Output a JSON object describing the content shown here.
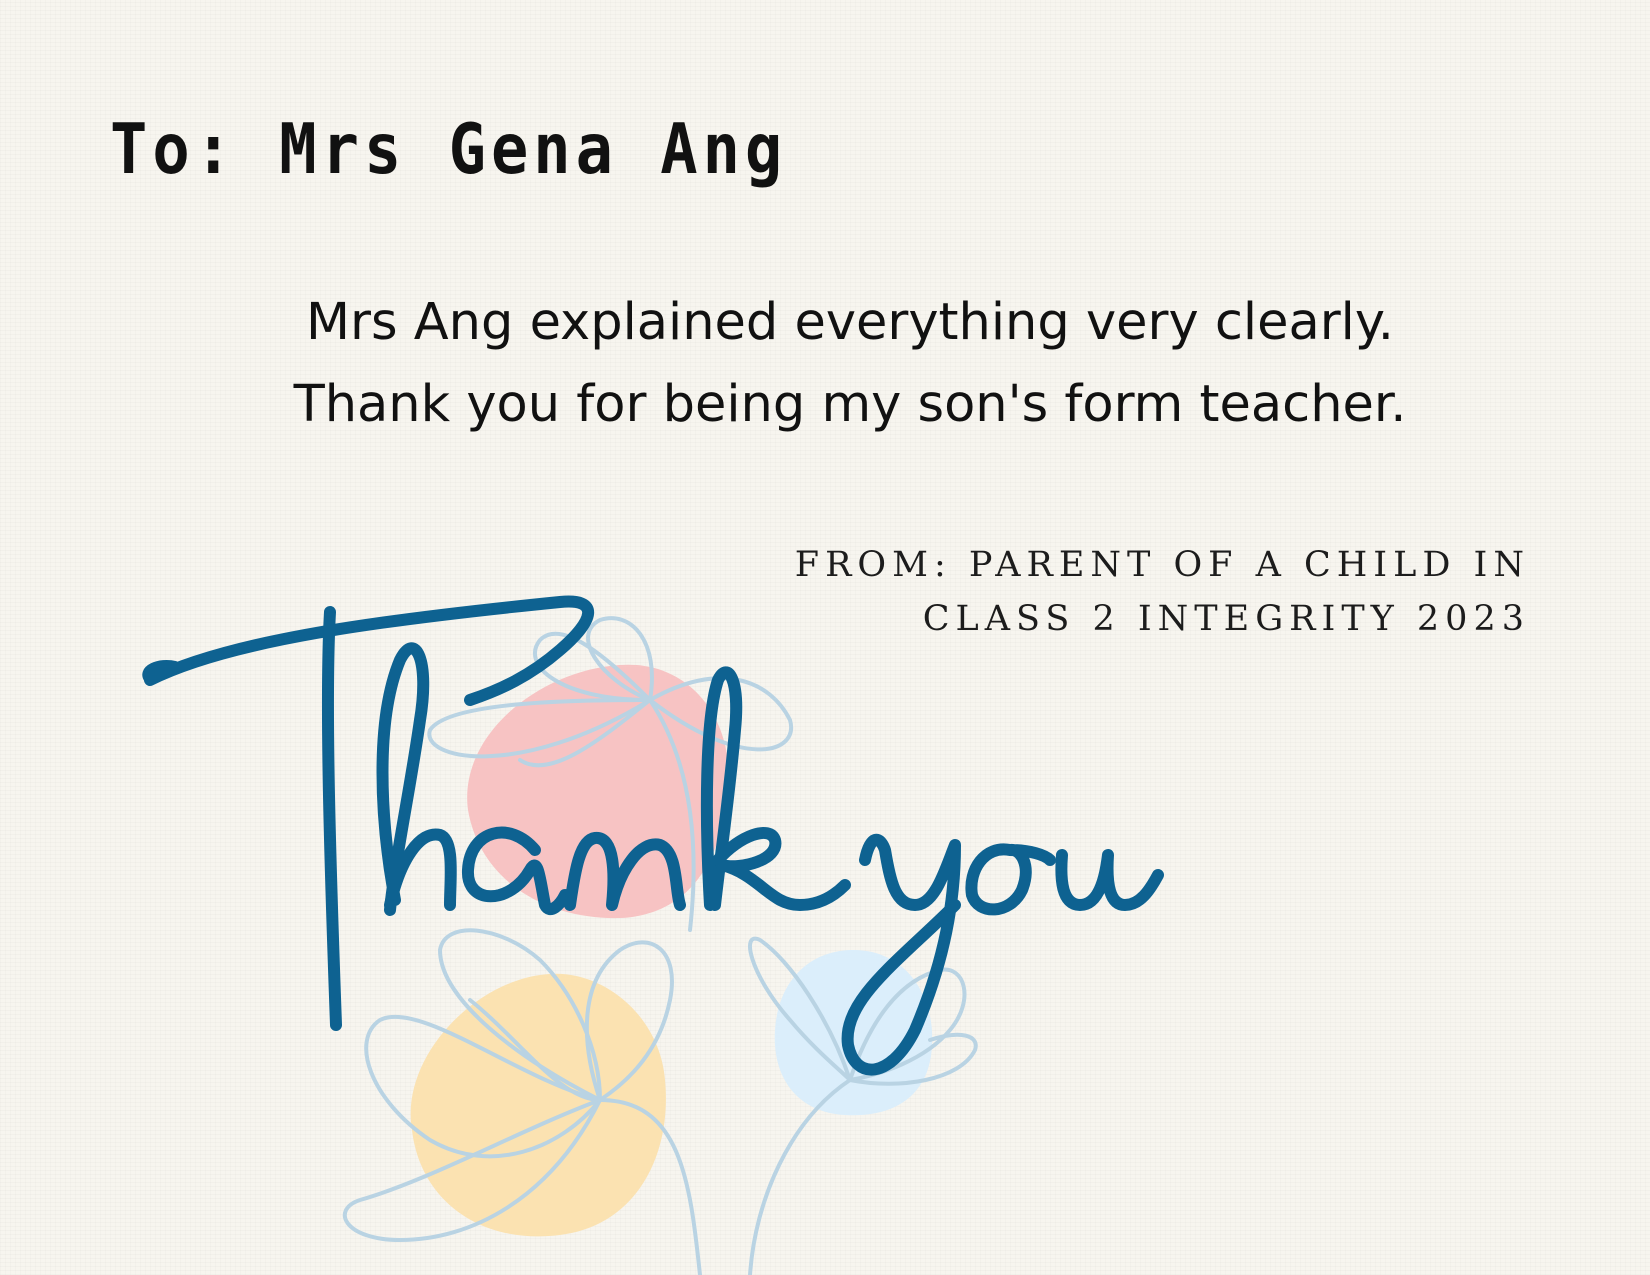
{
  "card": {
    "to_line": "To: Mrs Gena Ang",
    "message_lines": [
      "Mrs Ang explained everything very clearly.",
      "Thank you for being my son's form teacher."
    ],
    "from_lines": [
      "FROM: PARENT OF A CHILD IN",
      "CLASS 2 INTEGRITY 2023"
    ],
    "script_text": "Thank you"
  },
  "colors": {
    "script_blue": "#0e6291",
    "blob_pink": "#f7c3c3",
    "blob_yellow": "#fbe2b1",
    "blob_blue": "#dbeefb",
    "flower_outline": "#b9d3e3",
    "text_dark": "#111111"
  },
  "icons": {
    "decoration": "line-art-flowers-illustration",
    "script_lettering": "thank-you-script-lettering"
  }
}
